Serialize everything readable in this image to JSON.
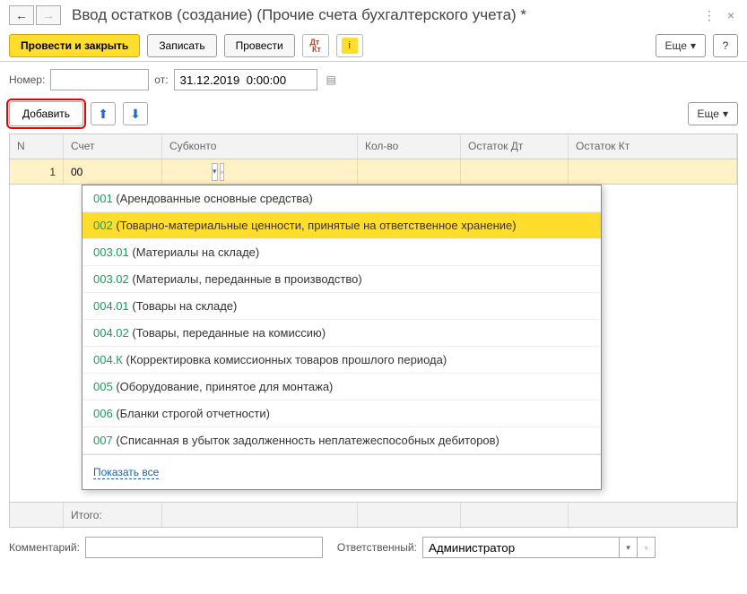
{
  "header": {
    "title": "Ввод остатков (создание) (Прочие счета бухгалтерского учета) *"
  },
  "toolbar": {
    "post_close": "Провести и закрыть",
    "save": "Записать",
    "post": "Провести",
    "more": "Еще"
  },
  "fields": {
    "number_label": "Номер:",
    "number_value": "",
    "date_label": "от:",
    "date_value": "31.12.2019  0:00:00"
  },
  "subtoolbar": {
    "add": "Добавить",
    "more": "Еще"
  },
  "table": {
    "headers": {
      "n": "N",
      "account": "Счет",
      "subconto": "Субконто",
      "qty": "Кол-во",
      "debit": "Остаток Дт",
      "credit": "Остаток Кт"
    },
    "row": {
      "n": "1",
      "account": "00"
    },
    "totals_label": "Итого:"
  },
  "dropdown": {
    "items": [
      {
        "code": "001",
        "desc": " (Арендованные основные средства)",
        "selected": false
      },
      {
        "code": "002",
        "desc": " (Товарно-материальные ценности, принятые на ответственное хранение)",
        "selected": true
      },
      {
        "code": "003.01",
        "desc": " (Материалы на складе)",
        "selected": false
      },
      {
        "code": "003.02",
        "desc": " (Материалы, переданные в производство)",
        "selected": false
      },
      {
        "code": "004.01",
        "desc": " (Товары на складе)",
        "selected": false
      },
      {
        "code": "004.02",
        "desc": " (Товары, переданные на комиссию)",
        "selected": false
      },
      {
        "code": "004.К",
        "desc": " (Корректировка комиссионных товаров прошлого периода)",
        "selected": false
      },
      {
        "code": "005",
        "desc": " (Оборудование, принятое для монтажа)",
        "selected": false
      },
      {
        "code": "006",
        "desc": " (Бланки строгой отчетности)",
        "selected": false
      },
      {
        "code": "007",
        "desc": " (Списанная в убыток задолженность неплатежеспособных дебиторов)",
        "selected": false
      }
    ],
    "show_all": "Показать все"
  },
  "footer": {
    "comment_label": "Комментарий:",
    "comment_value": "",
    "responsible_label": "Ответственный:",
    "responsible_value": "Администратор"
  }
}
